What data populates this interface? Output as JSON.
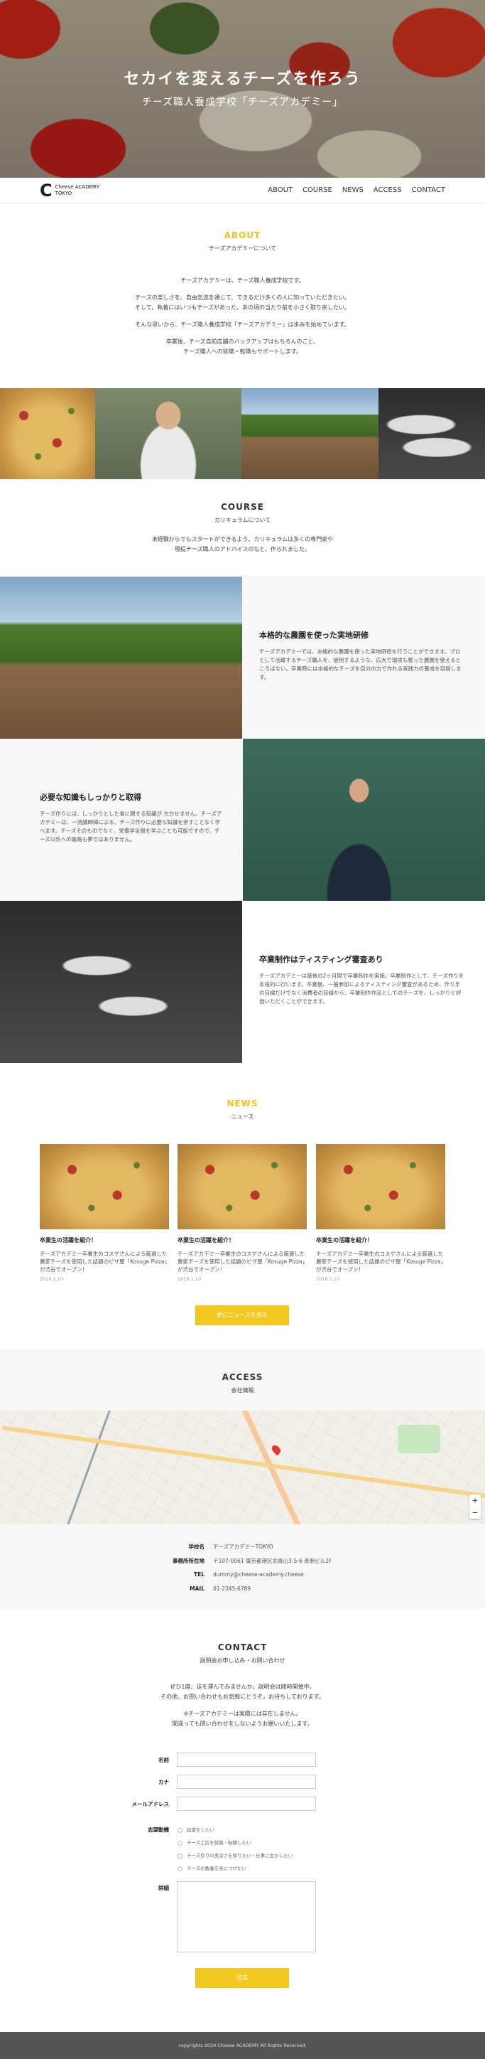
{
  "hero": {
    "title": "セカイを変えるチーズを作ろう",
    "subtitle": "チーズ職人養成学校「チーズアカデミー」"
  },
  "nav": {
    "logo_mark": "C",
    "logo_line1": "Cheese ACADEMY",
    "logo_line2": "TOKYO",
    "items": [
      "ABOUT",
      "COURSE",
      "NEWS",
      "ACCESS",
      "CONTACT"
    ]
  },
  "about": {
    "title": "ABOUT",
    "subtitle": "チーズアカデミーについて",
    "paragraphs": [
      "チーズアカデミーは、チーズ職人養成学校です。",
      "チーズの楽しさを、自由気流を通じて、できるだけ多くの人に知っていただきたい。",
      "そして、執着にはいつもチーズがあった、あの頃の当たり前を小さく取り戻したい。",
      "そんな思いから、チーズ職人養成学校「チーズアカデミー」は歩みを始めています。",
      "卒業後、チーズ自前店舗のバックアップはもちろんのこと、",
      "チーズ職人への就職・転職もサポートします。"
    ]
  },
  "course": {
    "title": "COURSE",
    "subtitle": "カリキュラムについて",
    "lines": [
      "未経験からでもスタートができるよう、カリキュラムは多くの専門家や",
      "現役チーズ職人のアドバイスのもと、作られました。"
    ],
    "blocks": [
      {
        "heading": "本格的な農園を使った実地研修",
        "body": "チーズアカデミーでは、本格的な農園を使った実地研修を行うことができます。プロとして活躍するチーズ職人を、使用するような、広大で環境も整った農園を使えるところはない。卒業時には本格的なチーズを自分の力で作れる実践力の養成を目指します。"
      },
      {
        "heading": "必要な知識もしっかりと取得",
        "body": "チーズ作りには、しっかりとした食に関する知識が 欠かせません。チーズアカデミーは、一流講師陣による、チーズ作りに必要な知識を余すことなく学べます。チーズそのものでなく、栄養学全般を学ぶことも可能ですので、チーズ以外への進路も夢ではありません。"
      },
      {
        "heading": "卒業制作はティスティング審査あり",
        "body": "チーズアカデミーは最後の2ヶ月間で卒業制作を実施。卒業制作として、チーズ作りを本格的に行います。卒業後、一般参加によるティスティング審査があるため、作り手の目線だけでなく消費者の目線から、卒業制作作品としてのチーズを、しっかりと評価いただくことができます。"
      }
    ]
  },
  "news": {
    "title": "NEWS",
    "subtitle": "ニュース",
    "items": [
      {
        "title": "卒業生の活躍を紹介！",
        "body": "チーズアカデミー卒業生のコスゲさんによる厳選した農家チーズを使用した話題のピザ屋「Kosuge Pizza」が渋谷でオープン！",
        "date": "2019.1.10"
      },
      {
        "title": "卒業生の活躍を紹介！",
        "body": "チーズアカデミー卒業生のコスゲさんによる厳選した農家チーズを使用した話題のピザ屋「Kosuge Pizza」が渋谷でオープン！",
        "date": "2019.1.10"
      },
      {
        "title": "卒業生の活躍を紹介！",
        "body": "チーズアカデミー卒業生のコスゲさんによる厳選した農家チーズを使用した話題のピザ屋「Kosuge Pizza」が渋谷でオープン！",
        "date": "2019.1.10"
      }
    ],
    "more_button": "更にニュースを見る"
  },
  "access": {
    "title": "ACCESS",
    "subtitle": "会社情報",
    "rows": [
      {
        "key": "学校名",
        "value": "チーズアカデミーTOKYO"
      },
      {
        "key": "事務所所在地",
        "value": "〒107-0061 東京都港区北青山3-5-6 青朋ビル2F"
      },
      {
        "key": "TEL",
        "value": "dummy@cheese-academy.cheese"
      },
      {
        "key": "MAIL",
        "value": "01-2345-6789"
      }
    ]
  },
  "contact": {
    "title": "CONTACT",
    "subtitle": "説明会お申し込み・お問い合わせ",
    "paragraphs": [
      "ぜひ1度、足を運んでみませんか。説明会は随時開催中。",
      "その他、お問い合わせもお気軽にどうぞ。お待ちしております。",
      "※チーズアカデミーは実際には存在しません。",
      "間違っても問い合わせをしないようお願いいたします。"
    ],
    "fields": {
      "name": "名前",
      "kana": "カナ",
      "email": "メールアドレス",
      "motive": "志望動機",
      "detail": "詳細"
    },
    "motive_options": [
      "起業をしたい",
      "チーズ工房を就職・転職したい",
      "チーズ作りの奥深さを知りたい・仕事に生かしたい",
      "チーズの教養を身につけたい"
    ],
    "submit": "送信"
  },
  "footer": {
    "copyright": "copyrights 2020 Cheese ACADEMY All Rights Reserved."
  }
}
